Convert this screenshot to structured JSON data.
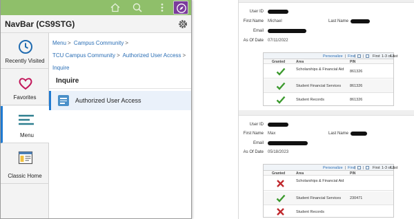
{
  "navbar": {
    "title": "NavBar (CS9STG)",
    "icons": {
      "home": "home-icon",
      "search": "search-icon",
      "more": "kebab-icon",
      "navbar": "compass-icon",
      "settings": "gear-icon"
    },
    "colors": {
      "topbar": "#8fbf6a",
      "navbar_button": "#7b3b9c",
      "link": "#2a6eb5",
      "accent": "#1f7ad1"
    }
  },
  "sidebar": {
    "items": [
      {
        "label": "Recently Visited",
        "icon": "clock-icon"
      },
      {
        "label": "Favorites",
        "icon": "heart-icon"
      },
      {
        "label": "Menu",
        "icon": "menu-lines-icon",
        "active": true
      },
      {
        "label": "Classic Home",
        "icon": "classic-home-icon"
      }
    ]
  },
  "breadcrumb": {
    "items": [
      "Menu",
      "Campus Community",
      "TCU Campus Community",
      "Authorized User Access",
      "Inquire"
    ],
    "separator": ">"
  },
  "section": {
    "title": "Inquire",
    "menu_item": "Authorized User Access"
  },
  "inquiry": {
    "labels": {
      "user_id": "User ID",
      "first_name": "First Name",
      "last_name": "Last Name",
      "email": "Email",
      "as_of_date": "As Of Date"
    },
    "grid_nav": {
      "personalize": "Personalize",
      "find": "Find",
      "first": "First",
      "last": "Last"
    },
    "columns": {
      "granted": "Granted",
      "area": "Area",
      "pin": "PIN"
    },
    "records": [
      {
        "first_name": "Michael",
        "as_of_date": "07/11/2022",
        "range": "1-3 of 3",
        "rows": [
          {
            "granted": true,
            "area": "Scholarships & Financial Aid",
            "pin": "861326"
          },
          {
            "granted": true,
            "area": "Student Financial Services",
            "pin": "861326"
          },
          {
            "granted": true,
            "area": "Student Records",
            "pin": "861326"
          }
        ]
      },
      {
        "first_name": "Max",
        "as_of_date": "05/18/2023",
        "range": "1-3 of 3",
        "rows": [
          {
            "granted": false,
            "area": "Scholarships & Financial Aid",
            "pin": ""
          },
          {
            "granted": true,
            "area": "Student Financial Services",
            "pin": "230471"
          },
          {
            "granted": false,
            "area": "Student Records",
            "pin": ""
          }
        ]
      }
    ]
  }
}
